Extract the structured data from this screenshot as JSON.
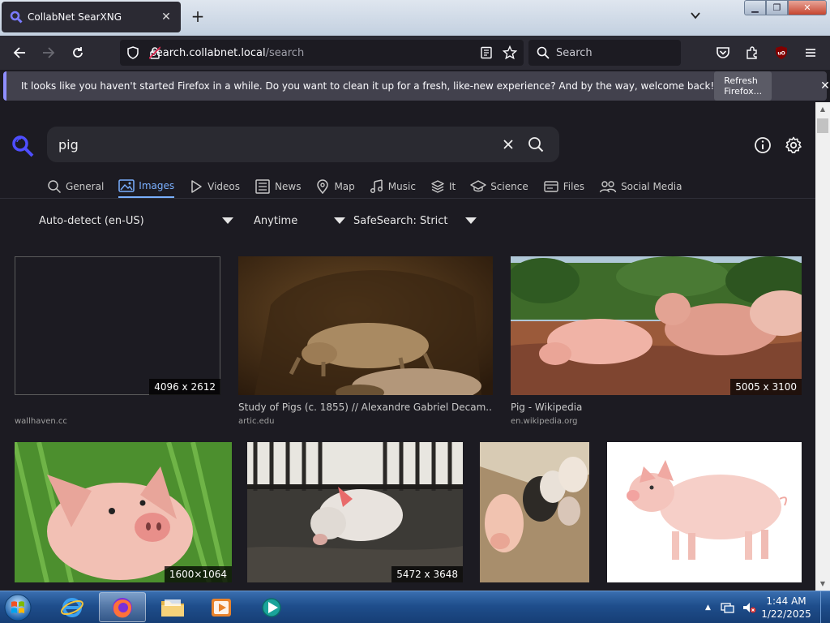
{
  "browser": {
    "tab_title": "CollabNet SearXNG",
    "url_host": "search.collabnet.local",
    "url_path": "/search",
    "search_placeholder": "Search",
    "notification_text": "It looks like you haven't started Firefox in a while. Do you want to clean it up for a fresh, like-new experience? And by the way, welcome back!",
    "refresh_label": "Refresh Firefox..."
  },
  "search": {
    "query": "pig",
    "categories": [
      {
        "label": "General",
        "icon": "search-icon"
      },
      {
        "label": "Images",
        "icon": "image-icon",
        "active": true
      },
      {
        "label": "Videos",
        "icon": "play-icon"
      },
      {
        "label": "News",
        "icon": "newspaper-icon"
      },
      {
        "label": "Map",
        "icon": "map-pin-icon"
      },
      {
        "label": "Music",
        "icon": "music-icon"
      },
      {
        "label": "It",
        "icon": "layers-icon"
      },
      {
        "label": "Science",
        "icon": "graduation-cap-icon"
      },
      {
        "label": "Files",
        "icon": "drive-icon"
      },
      {
        "label": "Social Media",
        "icon": "people-icon"
      }
    ],
    "filters": {
      "language": "Auto-detect (en-US)",
      "time": "Anytime",
      "safesearch": "SafeSearch: Strict"
    }
  },
  "results": [
    {
      "title": "",
      "source": "wallhaven.cc",
      "dims": "4096 x 2612"
    },
    {
      "title": "Study of Pigs (c. 1855) // Alexandre Gabriel Decam...",
      "source": "artic.edu",
      "dims": ""
    },
    {
      "title": "Pig - Wikipedia",
      "source": "en.wikipedia.org",
      "dims": "5005 x 3100"
    },
    {
      "title": "",
      "source": "",
      "dims": "1600×1064"
    },
    {
      "title": "",
      "source": "",
      "dims": "5472 x 3648"
    },
    {
      "title": "",
      "source": "",
      "dims": ""
    },
    {
      "title": "",
      "source": "",
      "dims": ""
    }
  ],
  "taskbar": {
    "time": "1:44 AM",
    "date": "1/22/2025"
  }
}
